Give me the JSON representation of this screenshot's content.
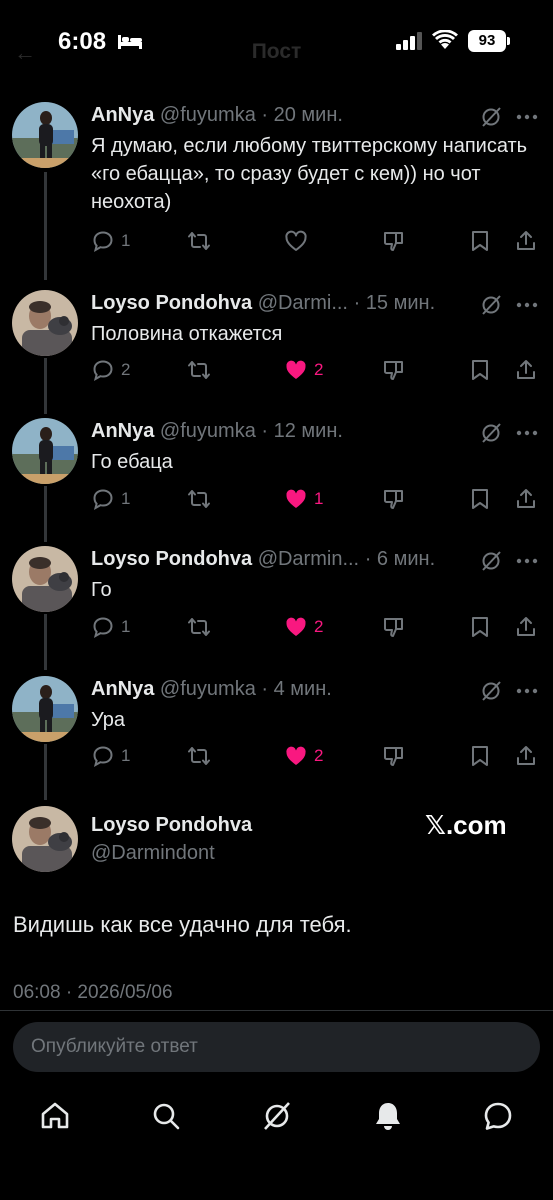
{
  "status_bar": {
    "time": "6:08",
    "battery": "93"
  },
  "header": {
    "title": "Пост",
    "back_label": "←"
  },
  "tweets": [
    {
      "name": "AnNya",
      "handle": "@fuyumka",
      "sep": "·",
      "time": "20 мин.",
      "text": "Я думаю, если любому твиттерскому написать «го ебацца», то сразу будет с кем)) но чот неохота)",
      "replies": "1",
      "retweets": "",
      "likes": "",
      "liked": false
    },
    {
      "name": "Loyso Pondohva",
      "handle": "@Darmi...",
      "sep": "·",
      "time": "15 мин.",
      "text": "Половина откажется",
      "replies": "2",
      "retweets": "",
      "likes": "2",
      "liked": true
    },
    {
      "name": "AnNya",
      "handle": "@fuyumka",
      "sep": "·",
      "time": "12 мин.",
      "text": "Го ебаца",
      "replies": "1",
      "retweets": "",
      "likes": "1",
      "liked": true
    },
    {
      "name": "Loyso Pondohva",
      "handle": "@Darmin...",
      "sep": "·",
      "time": "6 мин.",
      "text": "Го",
      "replies": "1",
      "retweets": "",
      "likes": "2",
      "liked": true
    },
    {
      "name": "AnNya",
      "handle": "@fuyumka",
      "sep": "·",
      "time": "4 мин.",
      "text": "Ура",
      "replies": "1",
      "retweets": "",
      "likes": "2",
      "liked": true
    }
  ],
  "main_tweet": {
    "name": "Loyso Pondohva",
    "handle": "@Darmindont",
    "watermark": "𝕏.com",
    "text": "Видишь как все удачно для тебя.",
    "meta": "06:08 · 2026/05/06"
  },
  "reply": {
    "placeholder": "Опубликуйте ответ"
  },
  "tabs": [
    "home-icon",
    "search-icon",
    "grok-icon",
    "notifications-icon",
    "messages-icon"
  ],
  "colors": {
    "background": "#000000",
    "like": "#f91880",
    "muted": "#71767b"
  }
}
